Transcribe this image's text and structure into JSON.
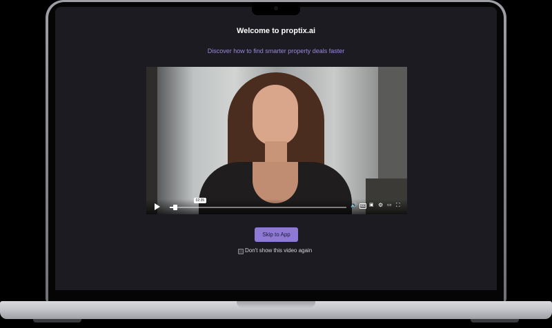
{
  "page": {
    "title": "Welcome to proptix.ai",
    "subtitle": "Discover how to find smarter property deals faster"
  },
  "video": {
    "current_time": "02:35",
    "progress": 0.03,
    "controls": [
      "play-icon",
      "volume-icon",
      "captions-icon",
      "miniplayer-icon",
      "settings-icon",
      "theater-icon",
      "fullscreen-icon"
    ]
  },
  "actions": {
    "skip_label": "Skip to App",
    "dont_show_label": "Don't show this video again",
    "dont_show_checked": false
  },
  "colors": {
    "screen_bg": "#1c1b21",
    "accent": "#8e7ad6",
    "subtitle": "#9b8ad8"
  }
}
